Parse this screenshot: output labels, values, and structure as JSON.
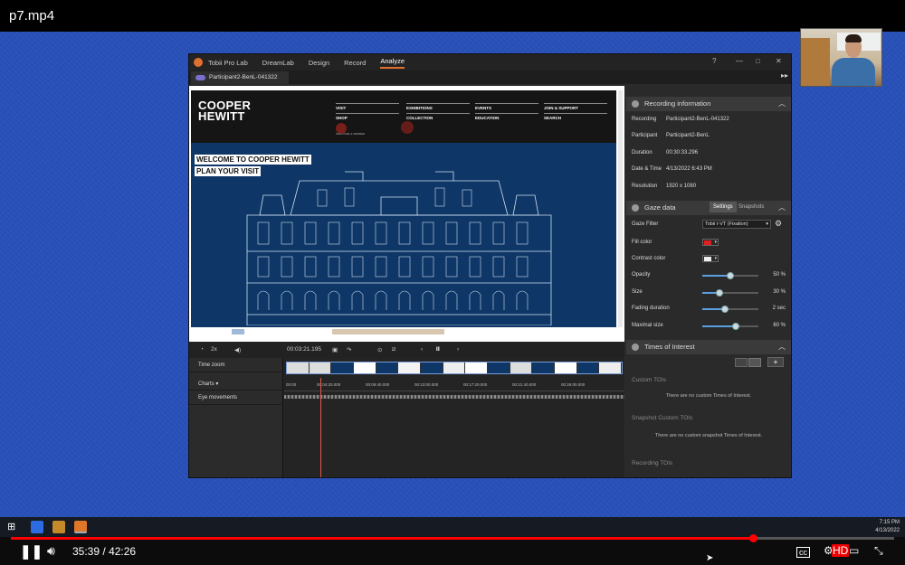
{
  "video": {
    "title": "p7.mp4",
    "current_time": "35:39",
    "time_separator": "/",
    "duration": "42:26",
    "progress": 0.84,
    "hd_badge": "HD"
  },
  "app": {
    "name": "Tobii Pro Lab",
    "nav": [
      "DreamLab",
      "Design",
      "Record",
      "Analyze"
    ],
    "active_nav": "Analyze",
    "tab": "Participant2-BenL-041322"
  },
  "stimulus": {
    "logo_line1": "COOPER",
    "logo_line2": "HEWITT",
    "nav": [
      {
        "label": "VISIT",
        "sub": "WELCOME & MEMBER"
      },
      {
        "label": "EXHIBITIONS",
        "sub": ""
      },
      {
        "label": "EVENTS",
        "sub": ""
      },
      {
        "label": "JOIN & SUPPORT",
        "sub": ""
      },
      {
        "label": "SHOP",
        "sub": ""
      },
      {
        "label": "COLLECTION",
        "sub": ""
      },
      {
        "label": "EDUCATION",
        "sub": ""
      },
      {
        "label": "SEARCH",
        "sub": ""
      }
    ],
    "banner1": "WELCOME TO COOPER HEWITT",
    "banner2": "PLAN YOUR VISIT"
  },
  "recording_info": {
    "title": "Recording information",
    "rows": [
      {
        "key": "Recording",
        "value": "Participant2-BenL-041322"
      },
      {
        "key": "Participant",
        "value": "Participant2-BenL"
      },
      {
        "key": "Duration",
        "value": "00:30:33.296"
      },
      {
        "key": "Date & Time",
        "value": "4/13/2022 6:43 PM"
      },
      {
        "key": "Resolution",
        "value": "1920 x 1080"
      }
    ]
  },
  "gaze_data": {
    "title": "Gaze data",
    "tab_settings": "Settings",
    "tab_snapshots": "Snapshots",
    "filter_label": "Gaze Filter",
    "filter_value": "Tobii I-VT (Fixation)",
    "fill_color_label": "Fill color",
    "fill_color": "#e02020",
    "contrast_color_label": "Contrast color",
    "contrast_color": "#eeeeee",
    "sliders": [
      {
        "label": "Opacity",
        "value": 0.5,
        "display": "50 %"
      },
      {
        "label": "Size",
        "value": 0.3,
        "display": "30 %"
      },
      {
        "label": "Fading duration",
        "value": 0.4,
        "display": "2 sec"
      },
      {
        "label": "Maximal size",
        "value": 0.6,
        "display": "60 %"
      }
    ]
  },
  "times_of_interest": {
    "title": "Times of Interest",
    "custom_title": "Custom TOIs",
    "custom_empty": "There are no custom Times of Interest.",
    "snapshot_title": "Snapshot Custom TOIs",
    "snapshot_empty": "There are no custom snapshot Times of Interest.",
    "recording_title": "Recording TOIs"
  },
  "timeline": {
    "speed": "2x",
    "time": "00:03:21.195",
    "lanes": [
      "Time zoom",
      "Charts",
      "Eye movements"
    ],
    "ruler": [
      "00:00",
      "00:04:20.000",
      "00:08:40.000",
      "00:13:00.000",
      "00:17:20.000",
      "00:21:40.000",
      "00:26:00.000"
    ]
  },
  "taskbar": {
    "time": "7:15 PM",
    "date": "4/13/2022"
  }
}
